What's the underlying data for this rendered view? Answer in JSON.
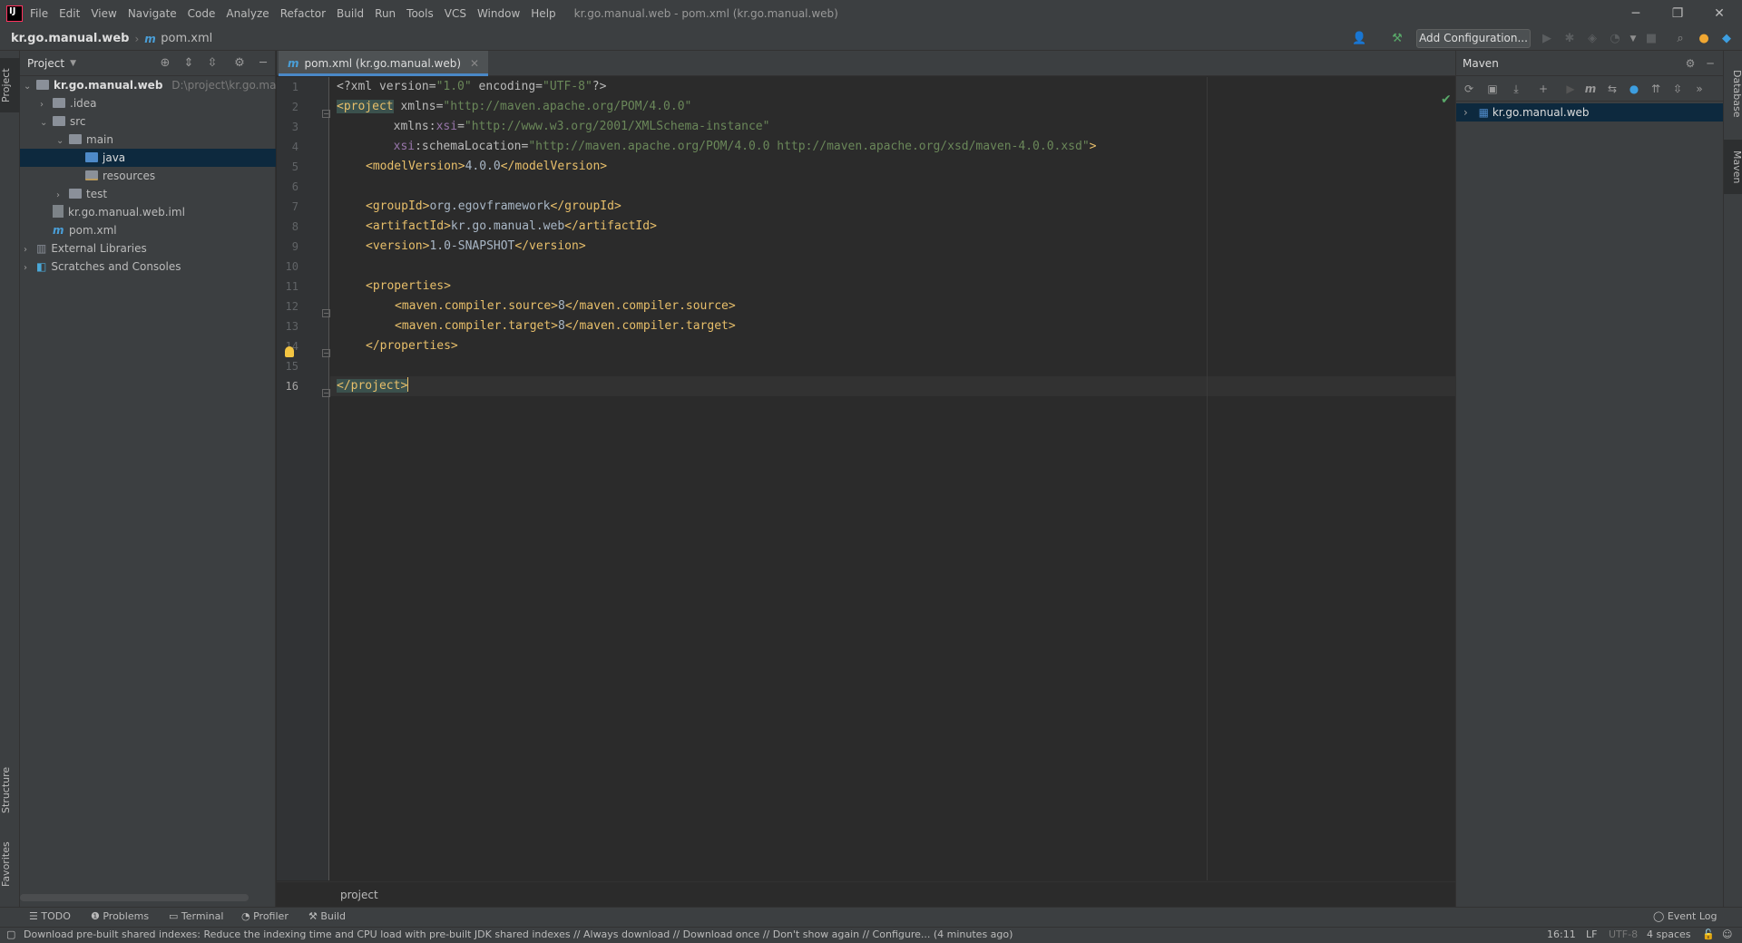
{
  "titlebar": {
    "menus": [
      "File",
      "Edit",
      "View",
      "Navigate",
      "Code",
      "Analyze",
      "Refactor",
      "Build",
      "Run",
      "Tools",
      "VCS",
      "Window",
      "Help"
    ],
    "window_title": "kr.go.manual.web - pom.xml (kr.go.manual.web)",
    "minimize": "─",
    "restore": "❐",
    "close": "✕"
  },
  "navbar": {
    "project": "kr.go.manual.web",
    "file": "pom.xml",
    "add_configuration": "Add Configuration..."
  },
  "left_strip": {
    "project_tab": "Project",
    "structure_tab": "Structure",
    "favorites_tab": "Favorites"
  },
  "project_panel": {
    "title": "Project",
    "root": {
      "name": "kr.go.manual.web",
      "path": "D:\\project\\kr.go.manu"
    },
    "items": [
      {
        "label": ".idea"
      },
      {
        "label": "src"
      },
      {
        "label": "main"
      },
      {
        "label": "java"
      },
      {
        "label": "resources"
      },
      {
        "label": "test"
      },
      {
        "label": "kr.go.manual.web.iml"
      },
      {
        "label": "pom.xml"
      },
      {
        "label": "External Libraries"
      },
      {
        "label": "Scratches and Consoles"
      }
    ]
  },
  "editor": {
    "tab_label": "pom.xml (kr.go.manual.web)",
    "line_numbers": [
      "1",
      "2",
      "3",
      "4",
      "5",
      "6",
      "7",
      "8",
      "9",
      "10",
      "11",
      "12",
      "13",
      "14",
      "15",
      "16"
    ],
    "breadcrumb": "project",
    "lines": {
      "l1a": "<?xml version=",
      "l1b": "\"1.0\"",
      "l1c": " encoding=",
      "l1d": "\"UTF-8\"",
      "l1e": "?>",
      "l2a": "<project",
      "l2b": " xmlns=",
      "l2c": "\"http://maven.apache.org/POM/4.0.0\"",
      "l3a": "        xmlns:",
      "l3b": "xsi",
      "l3c": "=",
      "l3d": "\"http://www.w3.org/2001/XMLSchema-instance\"",
      "l4a": "        ",
      "l4b": "xsi",
      "l4c": ":schemaLocation=",
      "l4d": "\"http://maven.apache.org/POM/4.0.0 http://maven.apache.org/xsd/maven-4.0.0.xsd\"",
      "l4e": ">",
      "l5a": "<modelVersion>",
      "l5b": "4.0.0",
      "l5c": "</modelVersion>",
      "l7a": "<groupId>",
      "l7b": "org.egovframework",
      "l7c": "</groupId>",
      "l8a": "<artifactId>",
      "l8b": "kr.go.manual.web",
      "l8c": "</artifactId>",
      "l9a": "<version>",
      "l9b": "1.0-SNAPSHOT",
      "l9c": "</version>",
      "l11": "<properties>",
      "l12a": "<maven.compiler.source>",
      "l12b": "8",
      "l12c": "</maven.compiler.source>",
      "l13a": "<maven.compiler.target>",
      "l13b": "8",
      "l13c": "</maven.compiler.target>",
      "l14": "</properties>",
      "l16": "</project>"
    }
  },
  "maven": {
    "title": "Maven",
    "project": "kr.go.manual.web"
  },
  "right_strip": {
    "database_tab": "Database",
    "maven_tab": "Maven"
  },
  "bottom_tabs": {
    "todo": "TODO",
    "problems": "Problems",
    "terminal": "Terminal",
    "profiler": "Profiler",
    "build": "Build",
    "event_log": "Event Log"
  },
  "status": {
    "message": "Download pre-built shared indexes: Reduce the indexing time and CPU load with pre-built JDK shared indexes // Always download // Download once // Don't show again // Configure... (4 minutes ago)",
    "position": "16:11",
    "line_sep": "LF",
    "encoding": "UTF-8",
    "indent": "4 spaces"
  }
}
